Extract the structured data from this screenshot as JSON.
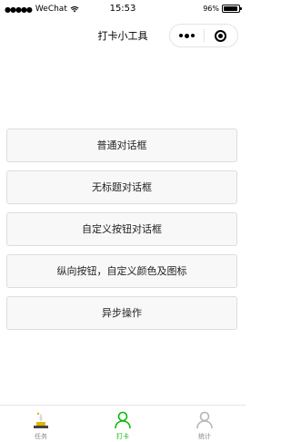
{
  "status_bar": {
    "signal_dots": "●●●●●",
    "carrier": "WeChat",
    "time": "15:53",
    "battery_percent": "96%",
    "battery_level": 0.96
  },
  "nav": {
    "title": "打卡小工具"
  },
  "buttons": [
    {
      "label": "普通对话框"
    },
    {
      "label": "无标题对话框"
    },
    {
      "label": "自定义按钮对话框"
    },
    {
      "label": "纵向按钮，自定义颜色及图标"
    },
    {
      "label": "异步操作"
    }
  ],
  "tabs": [
    {
      "label": "任务",
      "icon": "task-icon",
      "active": false
    },
    {
      "label": "打卡",
      "icon": "person-icon",
      "active": true
    },
    {
      "label": "统计",
      "icon": "person-icon",
      "active": false
    }
  ],
  "colors": {
    "active_tab": "#09bb07",
    "inactive_tab": "#888888",
    "button_bg": "#f8f8f8",
    "button_border": "#dddddd"
  }
}
